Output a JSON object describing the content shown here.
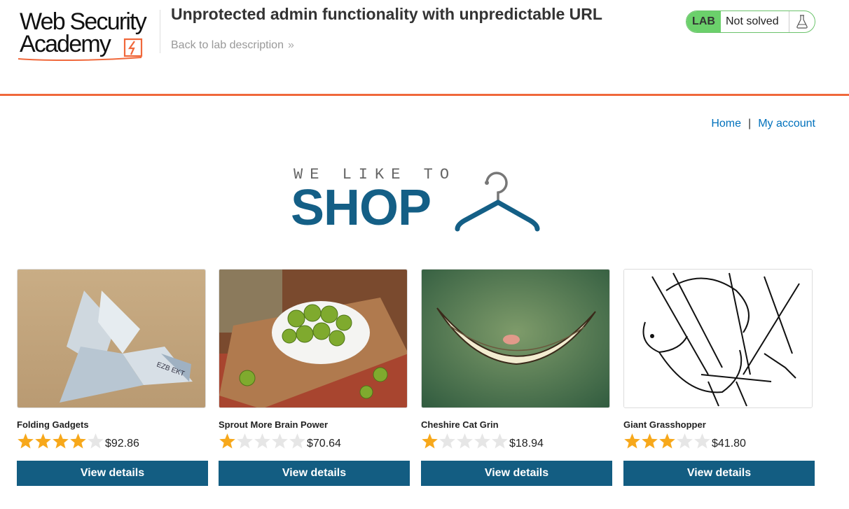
{
  "academy": {
    "logo_line1": "Web Security",
    "logo_line2": "Academy",
    "lab_title": "Unprotected admin functionality with unpredictable URL",
    "back_link": "Back to lab description",
    "lab_badge": "LAB",
    "lab_status": "Not solved",
    "accent_color": "#f0683b",
    "status_color": "#6bd06b"
  },
  "nav": {
    "home": "Home",
    "separator": "|",
    "my_account": "My account"
  },
  "banner": {
    "small_text": "WE LIKE TO",
    "big_text": "SHOP",
    "brand_color": "#145f86"
  },
  "products": [
    {
      "name": "Folding Gadgets",
      "rating": 4,
      "price": "$92.86",
      "button": "View details"
    },
    {
      "name": "Sprout More Brain Power",
      "rating": 1,
      "price": "$70.64",
      "button": "View details"
    },
    {
      "name": "Cheshire Cat Grin",
      "rating": 1,
      "price": "$18.94",
      "button": "View details"
    },
    {
      "name": "Giant Grasshopper",
      "rating": 3,
      "price": "$41.80",
      "button": "View details"
    }
  ]
}
